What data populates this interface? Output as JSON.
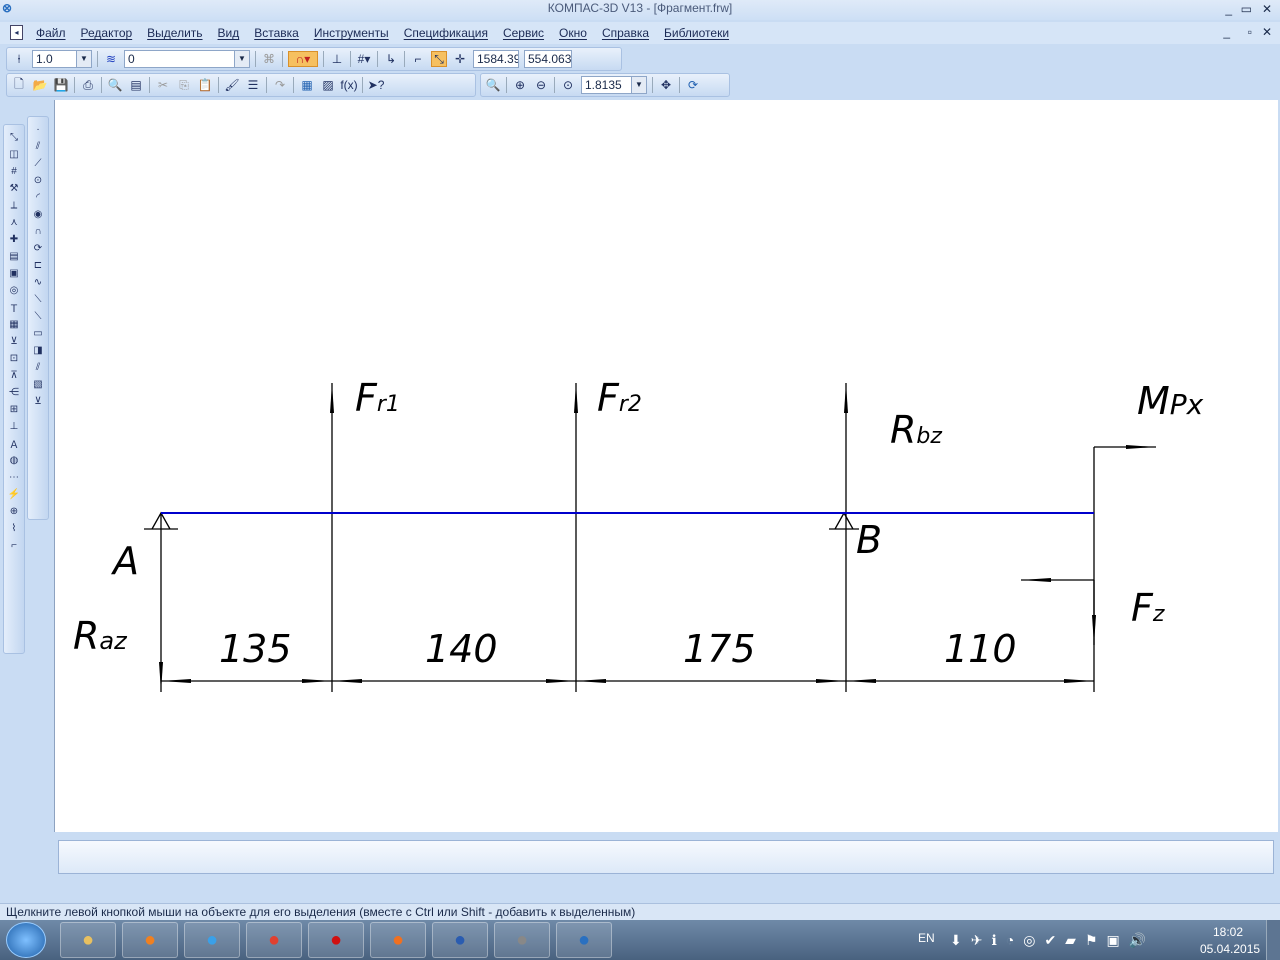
{
  "window": {
    "title": "КОМПАС-3D V13 - [Фрагмент.frw]"
  },
  "menu": [
    "Файл",
    "Редактор",
    "Выделить",
    "Вид",
    "Вставка",
    "Инструменты",
    "Спецификация",
    "Сервис",
    "Окно",
    "Справка",
    "Библиотеки"
  ],
  "toolbar1": {
    "step": "1.0",
    "layer": "0",
    "coord_x": "1584.39",
    "coord_y": "554.063"
  },
  "toolbar2": {
    "zoom": "1.8135"
  },
  "drawing": {
    "supports": [
      "A",
      "B"
    ],
    "forces": [
      {
        "base": "F",
        "sub": "r1"
      },
      {
        "base": "F",
        "sub": "r2"
      },
      {
        "base": "R",
        "sub": "bz"
      },
      {
        "base": "M",
        "sub": "Px"
      },
      {
        "base": "F",
        "sub": "z"
      },
      {
        "base": "R",
        "sub": "az"
      }
    ],
    "dimensions": [
      "135",
      "140",
      "175",
      "110"
    ],
    "beam_color": "#0000cc"
  },
  "status": "Щелкните левой кнопкой мыши на объекте для его выделения (вместе с Ctrl или Shift - добавить к выделенным)",
  "taskbar": {
    "lang": "EN",
    "time": "18:02",
    "date": "05.04.2015",
    "apps": [
      "start",
      "explorer",
      "media-player",
      "internet-explorer",
      "chrome",
      "acrobat",
      "firefox",
      "word",
      "calculator",
      "kompas"
    ]
  }
}
